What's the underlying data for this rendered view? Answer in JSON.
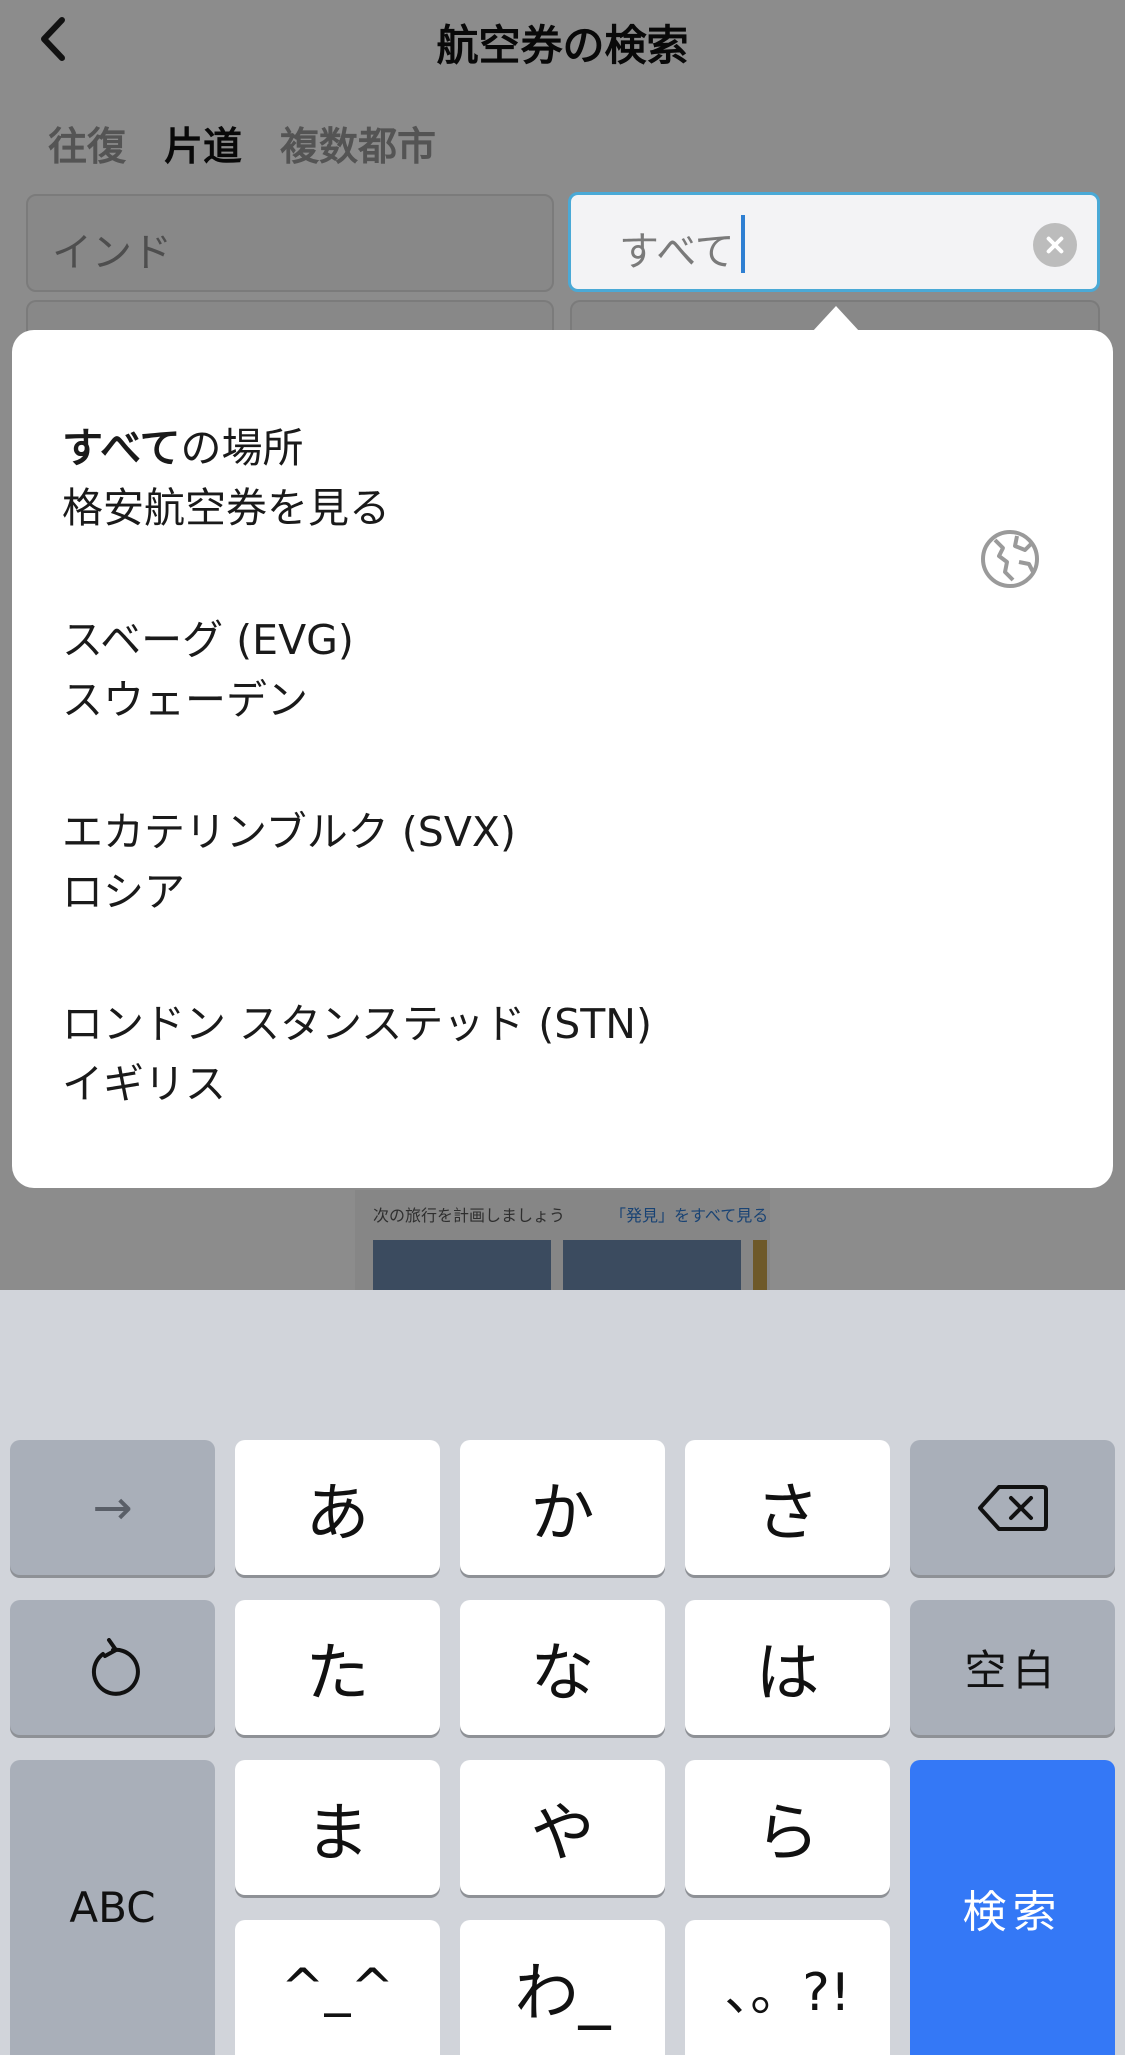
{
  "header": {
    "title": "航空券の検索",
    "back_icon": "chevron-left-icon"
  },
  "trip_tabs": [
    {
      "label": "往復",
      "active": false
    },
    {
      "label": "片道",
      "active": true
    },
    {
      "label": "複数都市",
      "active": false
    }
  ],
  "search": {
    "origin_value": "インド",
    "destination_value": "すべて"
  },
  "suggestions": [
    {
      "bold": "すべて",
      "line1_rest": "の場所",
      "line2": "格安航空券を見る",
      "icon": "globe-icon"
    },
    {
      "line1": "スベーグ (EVG)",
      "line2": "スウェーデン"
    },
    {
      "line1": "エカテリンブルク (SVX)",
      "line2": "ロシア"
    },
    {
      "line1": "ロンドン スタンステッド (STN)",
      "line2": "イギリス"
    }
  ],
  "background_promo": {
    "text": "次の旅行を計画しましょう",
    "link": "「発見」をすべて見る"
  },
  "keyboard": {
    "row1": [
      "→",
      "あ",
      "か",
      "さ"
    ],
    "row2": [
      "た",
      "な",
      "は",
      "空白"
    ],
    "row3": [
      "ABC",
      "ま",
      "や",
      "ら",
      "検索"
    ],
    "row4": [
      "^_^",
      "わ_",
      "、。?!"
    ],
    "delete_icon": "backspace-icon",
    "undo_icon": "undo-icon"
  },
  "colors": {
    "search_key": "#3478f6",
    "focus_border": "#4aa9d6",
    "caret": "#2e7fd2"
  }
}
